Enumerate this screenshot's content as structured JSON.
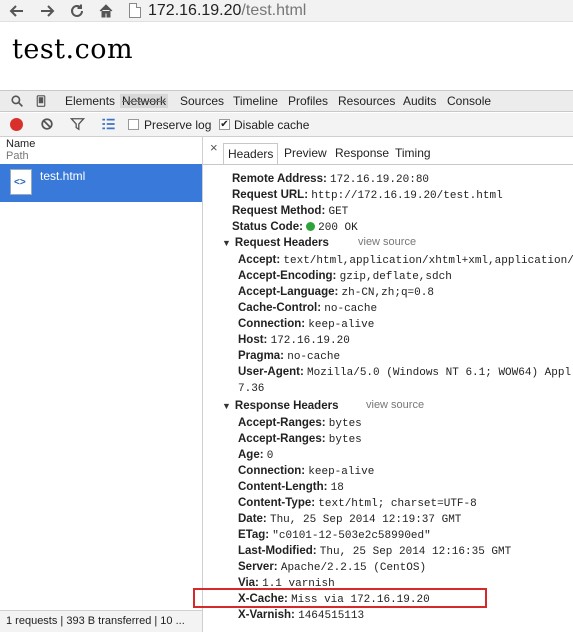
{
  "browser": {
    "url_host": "172.16.19.20",
    "url_path": "/test.html",
    "icons": [
      "back-arrow-icon",
      "forward-arrow-icon",
      "reload-icon",
      "home-icon",
      "page-icon"
    ]
  },
  "page": {
    "heading": "test.com"
  },
  "devtools": {
    "tabs": [
      "Elements",
      "Network",
      "Sources",
      "Timeline",
      "Profiles",
      "Resources",
      "Audits",
      "Console"
    ],
    "active_tab": "Network"
  },
  "toolbar": {
    "preserve_log": "Preserve log",
    "disable_cache": "Disable cache",
    "preserve_log_checked": false,
    "disable_cache_checked": true,
    "record_color": "#d9302c"
  },
  "request_list": {
    "col_name": "Name",
    "col_path": "Path",
    "request_name": "test.html",
    "status_summary": "1 requests | 393 B transferred | 10 ..."
  },
  "details": {
    "close": "×",
    "tabs": [
      "Headers",
      "Preview",
      "Response",
      "Timing"
    ],
    "active_tab": "Headers",
    "general": [
      {
        "key": "Remote Address:",
        "value": "172.16.19.20:80"
      },
      {
        "key": "Request URL:",
        "value": "http://172.16.19.20/test.html"
      },
      {
        "key": "Request Method:",
        "value": "GET"
      },
      {
        "key": "Status Code:",
        "value": "200 OK"
      }
    ],
    "request_headers_title": "Request Headers",
    "response_headers_title": "Response Headers",
    "view_source": "view source",
    "request_headers": [
      {
        "key": "Accept:",
        "value": "text/html,application/xhtml+xml,application/"
      },
      {
        "key": "Accept-Encoding:",
        "value": "gzip,deflate,sdch"
      },
      {
        "key": "Accept-Language:",
        "value": "zh-CN,zh;q=0.8"
      },
      {
        "key": "Cache-Control:",
        "value": "no-cache"
      },
      {
        "key": "Connection:",
        "value": "keep-alive"
      },
      {
        "key": "Host:",
        "value": "172.16.19.20"
      },
      {
        "key": "Pragma:",
        "value": "no-cache"
      },
      {
        "key": "User-Agent:",
        "value": "Mozilla/5.0 (Windows NT 6.1; WOW64) Appl"
      }
    ],
    "user_agent_cont": "7.36",
    "response_headers": [
      {
        "key": "Accept-Ranges:",
        "value": "bytes"
      },
      {
        "key": "Accept-Ranges:",
        "value": "bytes"
      },
      {
        "key": "Age:",
        "value": "0"
      },
      {
        "key": "Connection:",
        "value": "keep-alive"
      },
      {
        "key": "Content-Length:",
        "value": "18"
      },
      {
        "key": "Content-Type:",
        "value": "text/html; charset=UTF-8"
      },
      {
        "key": "Date:",
        "value": "Thu, 25 Sep 2014 12:19:37 GMT"
      },
      {
        "key": "ETag:",
        "value": "\"c0101-12-503e2c58990ed\""
      },
      {
        "key": "Last-Modified:",
        "value": "Thu, 25 Sep 2014 12:16:35 GMT"
      },
      {
        "key": "Server:",
        "value": "Apache/2.2.15 (CentOS)"
      },
      {
        "key": "Via:",
        "value": "1.1 varnish"
      },
      {
        "key": "X-Cache:",
        "value": "Miss via 172.16.19.20"
      },
      {
        "key": "X-Varnish:",
        "value": "1464515113"
      }
    ],
    "status_color": "#2ea33a",
    "highlight_color": "#d62a2a"
  }
}
